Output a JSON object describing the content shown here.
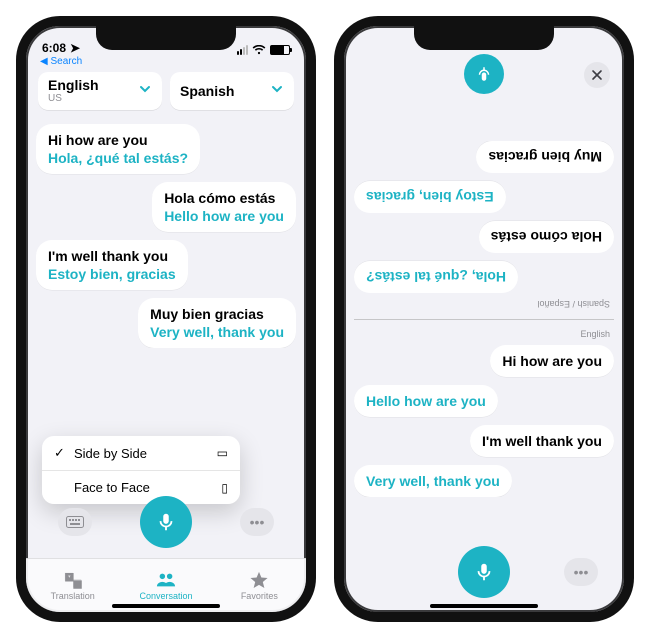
{
  "colors": {
    "accent": "#1db3c4",
    "bg": "#f2f2f7",
    "gray": "#8e8e93"
  },
  "status": {
    "time": "6:08",
    "back_label": "Search"
  },
  "lang_from": {
    "name": "English",
    "region": "US"
  },
  "lang_to": {
    "name": "Spanish",
    "region": ""
  },
  "bubbles": [
    {
      "side": "left",
      "src": "Hi how are you",
      "dst": "Hola, ¿qué tal estás?"
    },
    {
      "side": "right",
      "src": "Hola cómo estás",
      "dst": "Hello how are you"
    },
    {
      "side": "left",
      "src": "I'm well thank you",
      "dst": "Estoy bien, gracias"
    },
    {
      "side": "right",
      "src": "Muy bien gracias",
      "dst": "Very well, thank you"
    }
  ],
  "menu": {
    "items": [
      {
        "label": "Side by Side",
        "checked": true
      },
      {
        "label": "Face to Face",
        "checked": false
      }
    ]
  },
  "tabs": [
    {
      "label": "Translation",
      "active": false
    },
    {
      "label": "Conversation",
      "active": true
    },
    {
      "label": "Favorites",
      "active": false
    }
  ],
  "phone2": {
    "top_lang_label": "Spanish / Español",
    "bottom_lang_label": "English",
    "top_bubbles": [
      {
        "side": "right",
        "cls": "single2",
        "text": "Hola, ¿qué tal estás?"
      },
      {
        "side": "left",
        "cls": "single1",
        "text": "Hola cómo estás"
      },
      {
        "side": "right",
        "cls": "single2",
        "text": "Estoy bien, gracias"
      },
      {
        "side": "left",
        "cls": "single1",
        "text": "Muy bien gracias"
      }
    ],
    "bottom_bubbles": [
      {
        "side": "right",
        "cls": "single1",
        "text": "Hi how are you"
      },
      {
        "side": "left",
        "cls": "single2",
        "text": "Hello how are you"
      },
      {
        "side": "right",
        "cls": "single1",
        "text": "I'm well thank you"
      },
      {
        "side": "left",
        "cls": "single2",
        "text": "Very well, thank you"
      }
    ]
  }
}
